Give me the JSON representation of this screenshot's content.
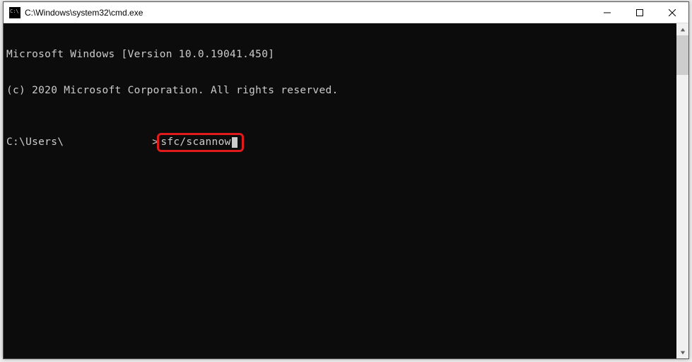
{
  "window": {
    "title": "C:\\Windows\\system32\\cmd.exe"
  },
  "terminal": {
    "line1": "Microsoft Windows [Version 10.0.19041.450]",
    "line2": "(c) 2020 Microsoft Corporation. All rights reserved.",
    "prompt_prefix": "C:\\Users\\",
    "prompt_suffix": ">",
    "command": "sfc/scannow"
  },
  "highlight": {
    "color": "#e11b1b"
  },
  "colors": {
    "terminal_bg": "#0c0c0c",
    "terminal_fg": "#cccccc",
    "titlebar_bg": "#ffffff"
  }
}
